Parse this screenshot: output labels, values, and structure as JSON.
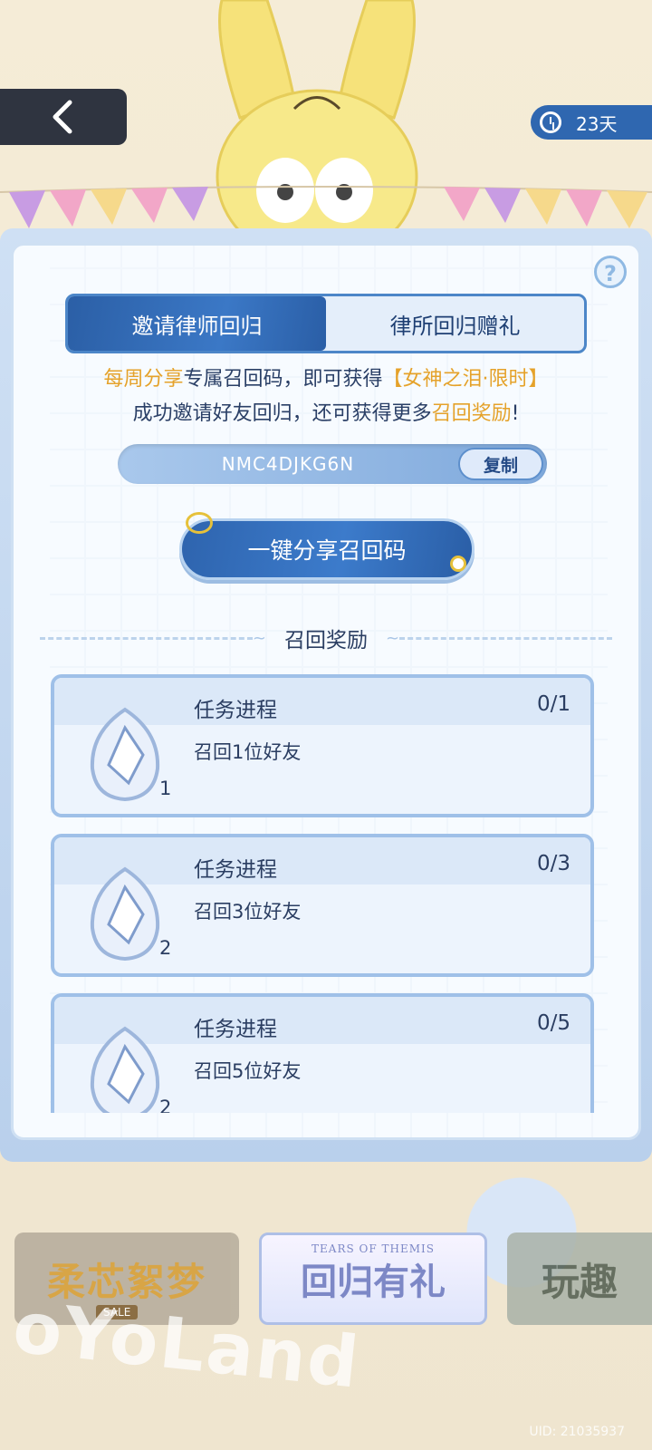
{
  "header": {
    "back_icon": "chevron-left-icon",
    "timer_icon": "clock-icon",
    "timer_text": "23天"
  },
  "tabs": [
    {
      "label": "邀请律师回归",
      "active": true
    },
    {
      "label": "律所回归赠礼",
      "active": false
    }
  ],
  "help_label": "?",
  "description": {
    "line1_part1": "每周分享",
    "line1_part2": "专属召回码，即可获得",
    "line1_part3": "【女神之泪·限时】",
    "line2_part1": "成功邀请好友回归，还可获得更多",
    "line2_part2": "召回奖励",
    "line2_part3": "!"
  },
  "code": {
    "value": "NMC4DJKG6N",
    "copy_label": "复制"
  },
  "share_button_label": "一键分享召回码",
  "section_title": "召回奖励",
  "tasks": [
    {
      "title": "任务进程",
      "progress": "0/1",
      "desc": "召回1位好友",
      "reward_count": "1"
    },
    {
      "title": "任务进程",
      "progress": "0/3",
      "desc": "召回3位好友",
      "reward_count": "2"
    },
    {
      "title": "任务进程",
      "progress": "0/5",
      "desc": "召回5位好友",
      "reward_count": "2"
    }
  ],
  "banners": [
    {
      "text": "柔芯絮梦",
      "sub": "SALE"
    },
    {
      "text": "回归有礼",
      "sub": "TEARS OF THEMIS"
    },
    {
      "text": "玩趣"
    }
  ],
  "watermark": "oYoLand",
  "uid": "UID: 21035937",
  "colors": {
    "accent_blue": "#2f67b0",
    "highlight_gold": "#e5a22a",
    "text_dark": "#2b3e62"
  }
}
